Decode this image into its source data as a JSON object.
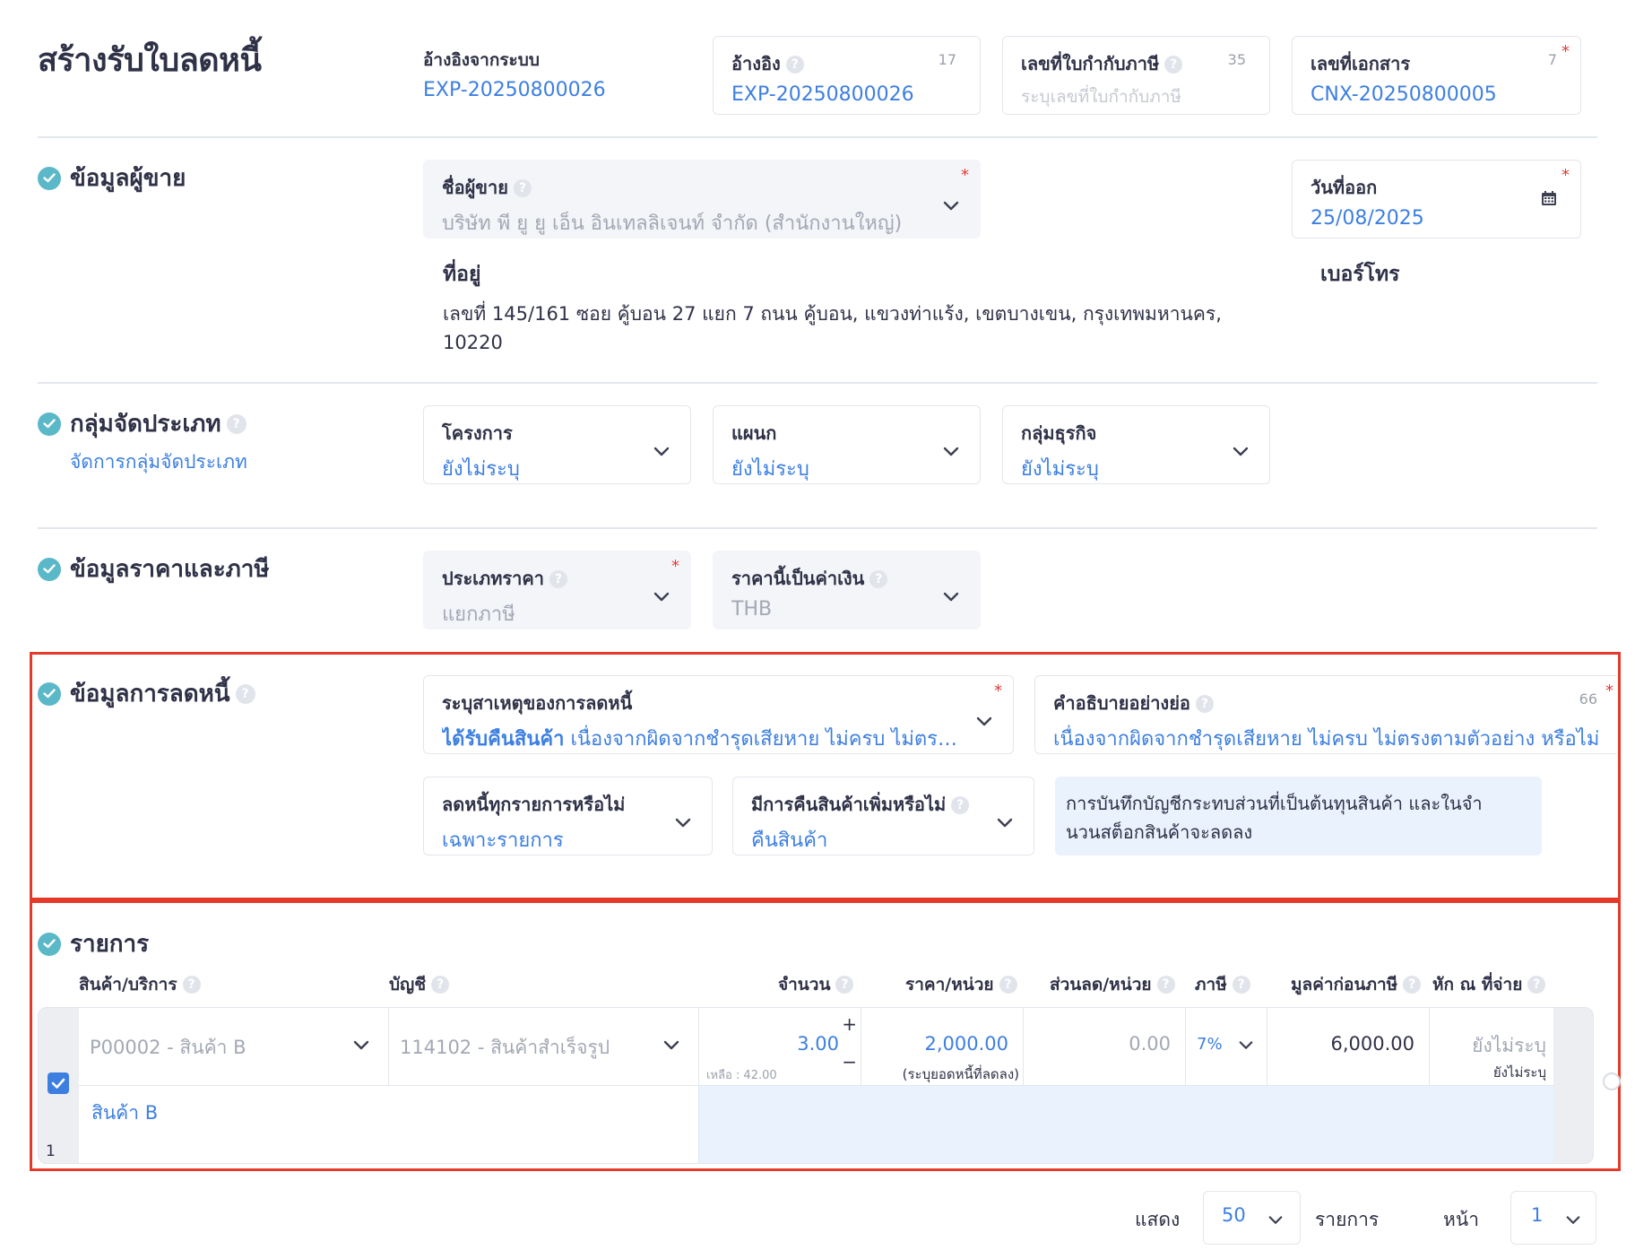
{
  "title": "สร้างรับใบลดหนี้",
  "header": {
    "sys_ref_label": "อ้างอิงจากระบบ",
    "sys_ref_value": "EXP-20250800026",
    "ref": {
      "label": "อ้างอิง",
      "value": "EXP-20250800026",
      "count": "17"
    },
    "tax_invoice": {
      "label": "เลขที่ใบกำกับภาษี",
      "placeholder": "ระบุเลขที่ใบกำกับภาษี",
      "count": "35"
    },
    "doc_no": {
      "label": "เลขที่เอกสาร",
      "value": "CNX-20250800005",
      "count": "7"
    }
  },
  "required_mark": "*",
  "seller": {
    "section_title": "ข้อมูลผู้ขาย",
    "name_label": "ชื่อผู้ขาย",
    "name_value": "บริษัท พี ยู ยู เอ็น อินเทลลิเจนท์ จำกัด (สำนักงานใหญ่)",
    "date_label": "วันที่ออก",
    "date_value": "25/08/2025",
    "address_label": "ที่อยู่",
    "address_line1": "เลขที่ 145/161 ซอย คู้บอน 27 แยก 7 ถนน คู้บอน, แขวงท่าแร้ง, เขตบางเขน, กรุงเทพมหานคร,",
    "address_line2": "10220",
    "phone_label": "เบอร์โทร"
  },
  "category": {
    "section_title": "กลุ่มจัดประเภท",
    "manage_link": "จัดการกลุ่มจัดประเภท",
    "project": {
      "label": "โครงการ",
      "value": "ยังไม่ระบุ"
    },
    "department": {
      "label": "แผนก",
      "value": "ยังไม่ระบุ"
    },
    "business": {
      "label": "กลุ่มธุรกิจ",
      "value": "ยังไม่ระบุ"
    }
  },
  "pricing": {
    "section_title": "ข้อมูลราคาและภาษี",
    "price_type": {
      "label": "ประเภทราคา",
      "value": "แยกภาษี"
    },
    "currency": {
      "label": "ราคานี้เป็นค่าเงิน",
      "value": "THB"
    }
  },
  "credit_note": {
    "section_title": "ข้อมูลการลดหนี้",
    "reason": {
      "label": "ระบุสาเหตุของการลดหนี้",
      "value_bold": "ได้รับคืนสินค้า",
      "value_rest": "เนื่องจากผิดจากชำรุดเสียหาย ไม่ครบ ไม่ตรง..."
    },
    "description": {
      "label": "คำอธิบายอย่างย่อ",
      "value": "เนื่องจากผิดจากชำรุดเสียหาย ไม่ครบ ไม่ตรงตามตัวอย่าง หรือไม่ต",
      "count": "66"
    },
    "all_items": {
      "label": "ลดหนี้ทุกรายการหรือไม่",
      "value": "เฉพาะรายการ"
    },
    "return_goods": {
      "label": "มีการคืนสินค้าเพิ่มหรือไม่",
      "value": "คืนสินค้า"
    },
    "note_line1": "การบันทึกบัญชีกระทบส่วนที่เป็นต้นทุนสินค้า และในจำ",
    "note_line2": "นวนสต็อกสินค้าจะลดลง"
  },
  "items": {
    "section_title": "รายการ",
    "columns": {
      "product": "สินค้า/บริการ",
      "account": "บัญชี",
      "qty": "จำนวน",
      "unit_price": "ราคา/หน่วย",
      "discount": "ส่วนลด/หน่วย",
      "tax": "ภาษี",
      "pre_tax": "มูลค่าก่อนภาษี",
      "withholding": "หัก ณ ที่จ่าย"
    },
    "rows": [
      {
        "index": "1",
        "checked": true,
        "product": "P00002 - สินค้า B",
        "account": "114102 - สินค้าสำเร็จรูป",
        "qty": "3.00",
        "remaining": "เหลือ : 42.00",
        "unit_price": "2,000.00",
        "unit_price_note": "(ระบุยอดหนี้ที่ลดลง)",
        "discount": "0.00",
        "tax": "7%",
        "pre_tax": "6,000.00",
        "withholding": "ยังไม่ระบุ",
        "withholding_sub": "ยังไม่ระบุ",
        "description": "สินค้า B"
      }
    ],
    "plus": "+",
    "minus": "−"
  },
  "pagination": {
    "show_label": "แสดง",
    "page_size": "50",
    "items_label": "รายการ",
    "page_label": "หน้า",
    "page": "1"
  },
  "colors": {
    "accent": "#3d7fe0",
    "check": "#5bb8c8",
    "highlight": "#e53a2a",
    "required": "#e53935"
  }
}
